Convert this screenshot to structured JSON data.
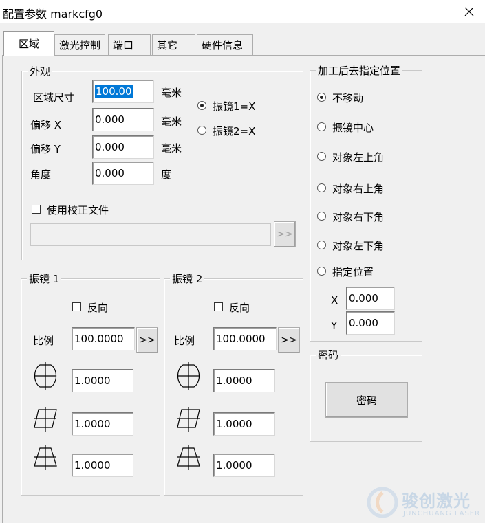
{
  "window": {
    "title": "配置参数 markcfg0"
  },
  "tabs": [
    "区域",
    "激光控制",
    "端口",
    "其它",
    "硬件信息"
  ],
  "appearance": {
    "title": "外观",
    "size_label": "区域尺寸",
    "size_value": "100.00",
    "size_unit": "毫米",
    "offset_x_label": "偏移 X",
    "offset_x_value": "0.000",
    "offset_x_unit": "毫米",
    "offset_y_label": "偏移 Y",
    "offset_y_value": "0.000",
    "offset_y_unit": "毫米",
    "angle_label": "角度",
    "angle_value": "0.000",
    "angle_unit": "度",
    "galvo1_x_label": "振镜1=X",
    "galvo2_x_label": "振镜2=X",
    "use_correction_label": "使用校正文件",
    "correction_file_value": "",
    "browse_label": ">>"
  },
  "galvo1": {
    "title": "振镜 1",
    "reverse_label": "反向",
    "ratio_label": "比例",
    "ratio_value": "100.0000",
    "ratio_button": ">>",
    "bulge_value": "1.0000",
    "parallelogram_value": "1.0000",
    "trapezoid_value": "1.0000"
  },
  "galvo2": {
    "title": "振镜 2",
    "reverse_label": "反向",
    "ratio_label": "比例",
    "ratio_value": "100.0000",
    "ratio_button": ">>",
    "bulge_value": "1.0000",
    "parallelogram_value": "1.0000",
    "trapezoid_value": "1.0000"
  },
  "after_process": {
    "title": "加工后去指定位置",
    "options": [
      "不移动",
      "振镜中心",
      "对象左上角",
      "对象右上角",
      "对象右下角",
      "对象左下角",
      "指定位置"
    ],
    "selected": "不移动",
    "x_label": "X",
    "x_value": "0.000",
    "y_label": "Y",
    "y_value": "0.000"
  },
  "password": {
    "title": "密码",
    "button_label": "密码"
  },
  "watermark": {
    "text": "骏创激光",
    "subtext": "JUNCHUANG LASER"
  },
  "icons": {
    "close": "close-icon",
    "bulge": "barrel-distortion-icon",
    "parallelogram": "parallelogram-distortion-icon",
    "trapezoid": "trapezoid-distortion-icon"
  }
}
